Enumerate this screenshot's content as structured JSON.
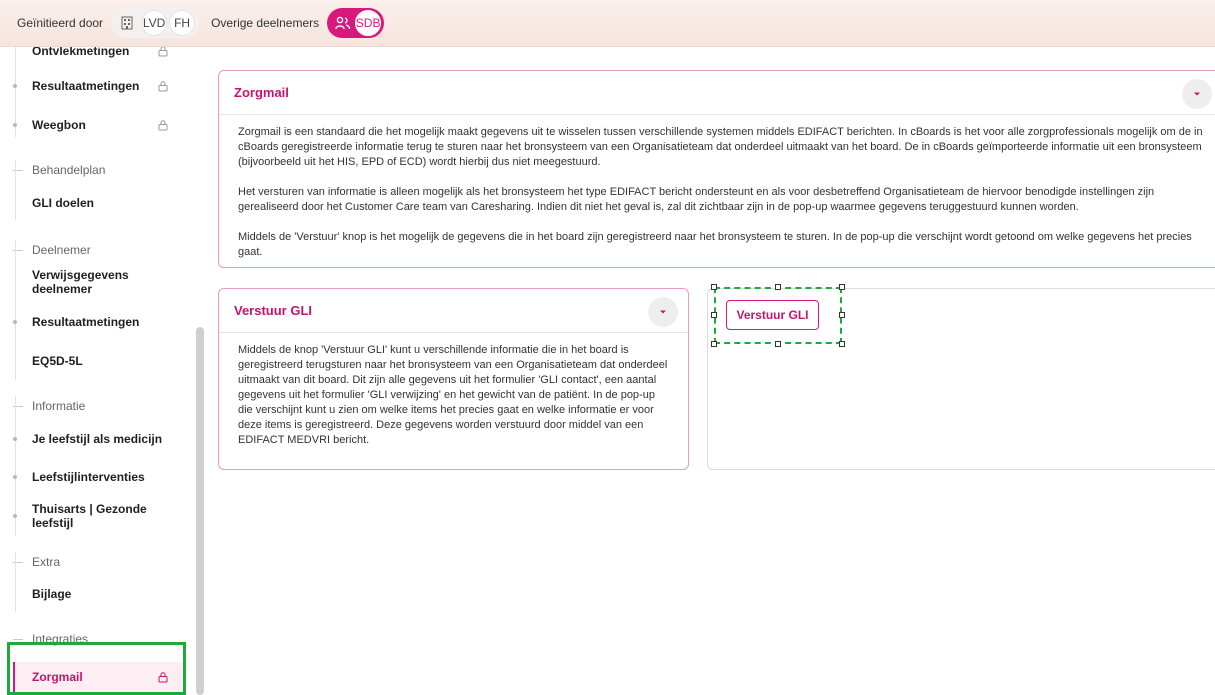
{
  "header": {
    "initiated_label": "Geïnitieerd door",
    "initiators": [
      "LVD",
      "FH"
    ],
    "other_label": "Overige deelnemers",
    "participants": [
      "SDB"
    ]
  },
  "sidebar": {
    "cut_item": "Ontvlekmetingen",
    "items_top": [
      {
        "label": "Resultaatmetingen",
        "locked": true
      },
      {
        "label": "Weegbon",
        "locked": true
      }
    ],
    "sections": {
      "behandelplan": "Behandelplan",
      "deelnemer": "Deelnemer",
      "informatie": "Informatie",
      "extra": "Extra",
      "integraties": "Integraties"
    },
    "gli_doelen": "GLI doelen",
    "verwijsgegevens": "Verwijsgegevens deelnemer",
    "resultaatmetingen2": "Resultaatmetingen",
    "eq5d": "EQ5D-5L",
    "info_items": [
      "Je leefstijl als medicijn",
      "Leefstijlinterventies",
      "Thuisarts | Gezonde leefstijl"
    ],
    "bijlage": "Bijlage",
    "zorgmail": "Zorgmail"
  },
  "zorgmail_card": {
    "title": "Zorgmail",
    "paragraphs": [
      "Zorgmail is een standaard die het mogelijk maakt gegevens uit te wisselen tussen verschillende systemen middels EDIFACT berichten. In cBoards is het voor alle zorgprofessionals mogelijk om de in cBoards geregistreerde informatie terug te sturen naar het bronsysteem van een Organisatieteam dat onderdeel uitmaakt van het board. De in cBoards geïmporteerde informatie uit een bronsysteem (bijvoorbeeld uit het HIS, EPD of ECD) wordt hierbij dus niet meegestuurd.",
      "Het versturen van informatie is alleen mogelijk als het bronsysteem het type EDIFACT bericht ondersteunt en als voor desbetreffend Organisatieteam de hiervoor benodigde instellingen zijn gerealiseerd door het Customer Care team van Caresharing. Indien dit niet het geval is, zal dit zichtbaar zijn in de pop-up waarmee gegevens teruggestuurd kunnen worden.",
      "Middels de 'Verstuur' knop is het mogelijk de gegevens die in het board zijn geregistreerd naar het bronsysteem te sturen. In de pop-up die verschijnt wordt getoond om welke gegevens het precies gaat."
    ]
  },
  "verstuur_card": {
    "title": "Verstuur GLI",
    "text": "Middels de knop 'Verstuur GLI' kunt u verschillende informatie die in het board is geregistreerd terugsturen naar het bronsysteem van een Organisatieteam dat onderdeel uitmaakt van dit board. Dit zijn alle gegevens uit het formulier 'GLI contact', een aantal gegevens uit het formulier 'GLI verwijzing' en het gewicht van de patiënt. In de pop-up die verschijnt kunt u zien om welke items het precies gaat en welke informatie er voor deze items is geregistreerd. Deze gegevens worden verstuurd door middel van een EDIFACT MEDVRI bericht."
  },
  "action": {
    "button_label": "Verstuur GLI"
  },
  "colors": {
    "accent": "#d8197b",
    "accent_text": "#c2156d",
    "focus": "#1eaa3b"
  }
}
